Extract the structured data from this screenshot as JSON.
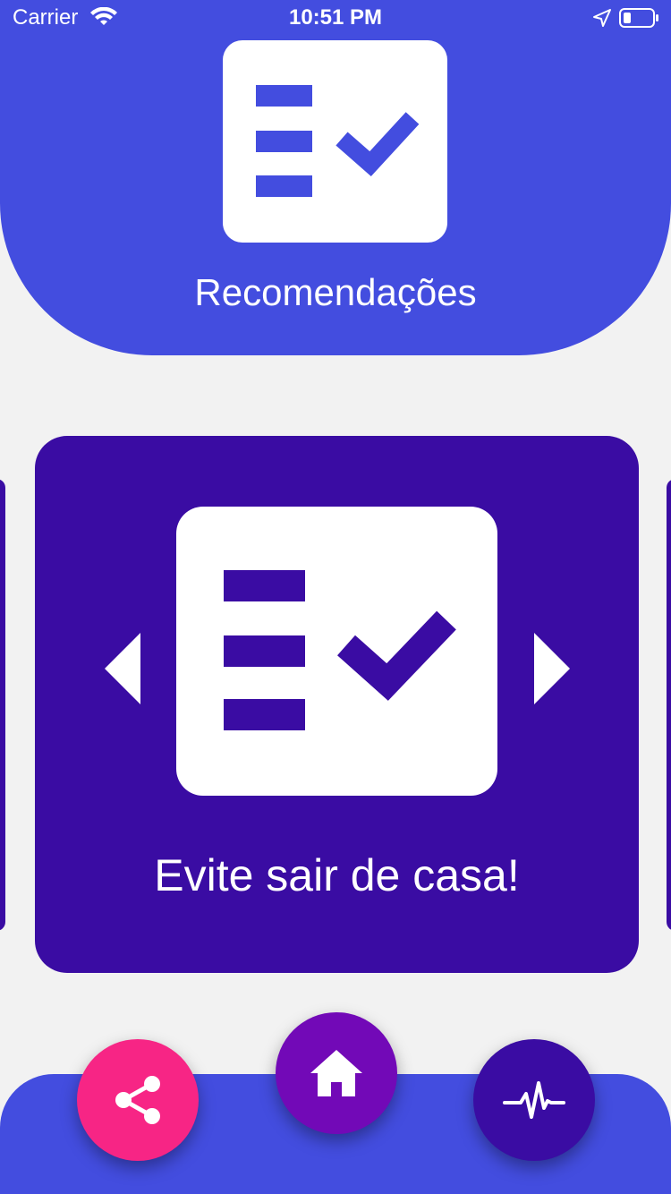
{
  "status_bar": {
    "carrier": "Carrier",
    "time": "10:51 PM"
  },
  "header": {
    "title": "Recomendações",
    "icon": "checklist-icon"
  },
  "card": {
    "text": "Evite sair de casa!",
    "icon": "checklist-icon"
  },
  "nav": {
    "share_icon": "share-icon",
    "home_icon": "home-icon",
    "pulse_icon": "heartbeat-icon"
  },
  "colors": {
    "header_blue": "#434ddf",
    "card_purple": "#3a0ca3",
    "share_pink": "#f72585",
    "home_violet": "#7209b7",
    "background": "#f2f2f2"
  }
}
